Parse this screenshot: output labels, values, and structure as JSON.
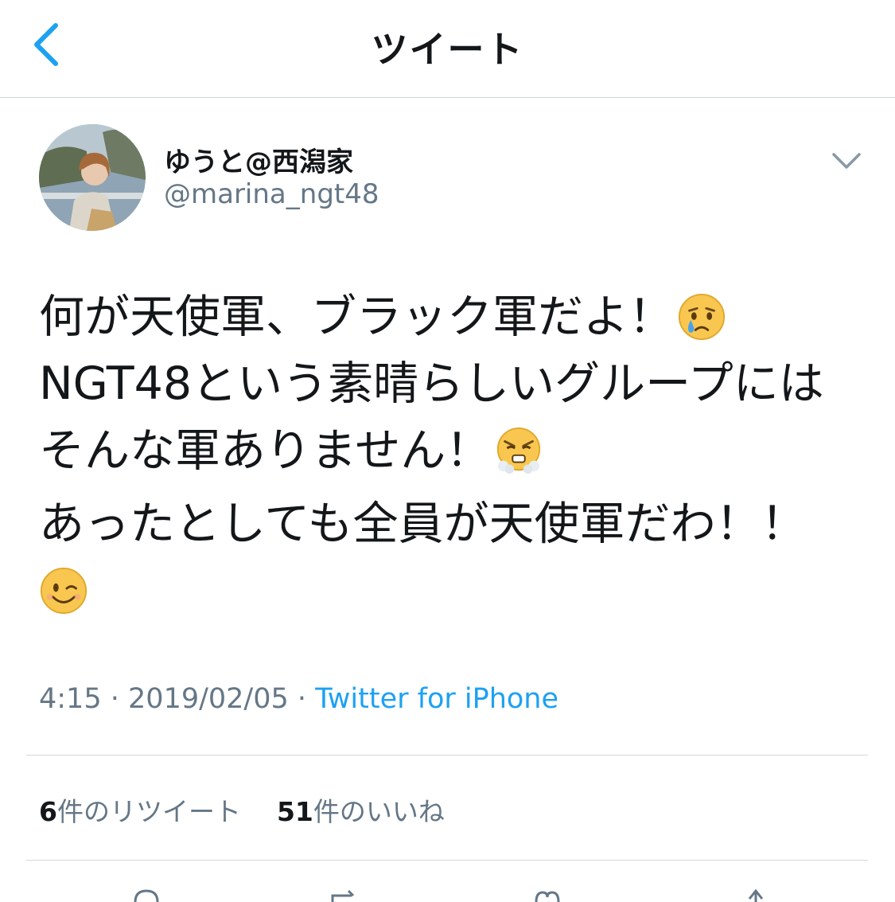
{
  "nav": {
    "title": "ツイート",
    "back_icon": "chevron-left-icon",
    "accent_color": "#1da1f2"
  },
  "user": {
    "display_name": "ゆうと@西潟家",
    "handle": "@marina_ngt48"
  },
  "tweet": {
    "lines": [
      {
        "text": "何が天使軍、ブラック軍だよ！",
        "emoji": "crying-face"
      },
      {
        "text": "NGT48という素晴らしいグループには"
      },
      {
        "text": "そんな軍ありません！",
        "emoji": "face-with-steam-from-nose"
      },
      {
        "text": "あったとしても全員が天使軍だわ！！"
      },
      {
        "text": "",
        "emoji": "winking-face"
      }
    ],
    "time": "4:15",
    "date": "2019/02/05",
    "separator": "·",
    "source": "Twitter for iPhone"
  },
  "stats": {
    "retweets_count": "6",
    "retweets_label": "件のリツイート",
    "likes_count": "51",
    "likes_label": "件のいいね"
  },
  "actions": [
    "reply-icon",
    "retweet-icon",
    "like-icon",
    "share-icon"
  ]
}
